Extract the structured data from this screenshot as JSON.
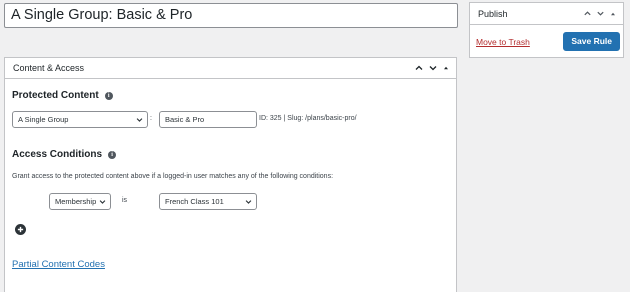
{
  "post_title": "A Single Group: Basic & Pro",
  "publish": {
    "title": "Publish",
    "move_to_trash": "Move to Trash",
    "save_label": "Save Rule"
  },
  "content_access": {
    "title": "Content & Access",
    "protected": {
      "heading": "Protected Content",
      "type_select": "A Single Group",
      "separator": ":",
      "group_value": "Basic & Pro",
      "meta": "ID: 325 | Slug: /plans/basic-pro/"
    },
    "conditions": {
      "heading": "Access Conditions",
      "description": "Grant access to the protected content above if a logged-in user matches any of the following conditions:",
      "field_select": "Membership",
      "operator": "is",
      "value_select": "French Class 101"
    },
    "partial_link": "Partial Content Codes"
  },
  "colors": {
    "primary": "#2271b1",
    "danger": "#b32d2e",
    "background": "#f0f0f1"
  }
}
